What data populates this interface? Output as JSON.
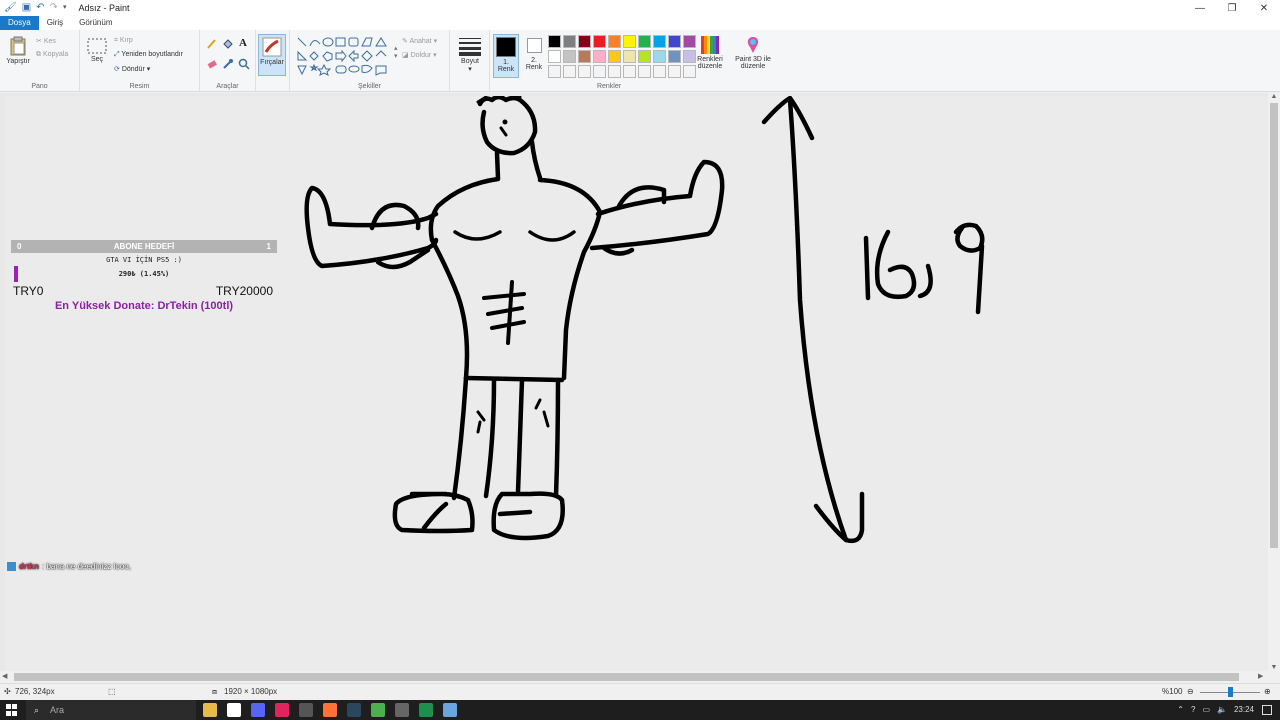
{
  "window": {
    "title": "Adsız - Paint",
    "controls": {
      "minimize": "—",
      "maximize": "❐",
      "close": "✕"
    }
  },
  "tabs": [
    {
      "label": "Dosya",
      "active": true
    },
    {
      "label": "Giriş",
      "active": false
    },
    {
      "label": "Görünüm",
      "active": false
    }
  ],
  "ribbon": {
    "pano": {
      "label": "Pano",
      "paste": "Yapıştır",
      "cut": "Kes",
      "copy": "Kopyala"
    },
    "resim": {
      "label": "Resim",
      "select": "Seç",
      "crop": "Kırp",
      "resize": "Yeniden boyutlandır",
      "rotate": "Döndür"
    },
    "araclar": {
      "label": "Araçlar"
    },
    "brushes": {
      "label": "Fırçalar"
    },
    "sekiller": {
      "label": "Şekiller",
      "outline": "Anahat",
      "fill": "Doldur"
    },
    "size": {
      "label": "Boyut"
    },
    "renkler": {
      "label": "Renkler",
      "color1": "1. Renk",
      "color2": "2. Renk",
      "edit_colors": "Renkleri düzenle",
      "paint3d": "Paint 3D ile düzenle",
      "color1_value": "#000000",
      "color2_value": "#ffffff",
      "palette": [
        "#000000",
        "#7f7f7f",
        "#880015",
        "#ed1c24",
        "#ff7f27",
        "#fff200",
        "#22b14c",
        "#00a2e8",
        "#3f48cc",
        "#a349a4",
        "#ffffff",
        "#c3c3c3",
        "#b97a57",
        "#ffaec9",
        "#ffc90e",
        "#efe4b0",
        "#b5e61d",
        "#99d9ea",
        "#7092be",
        "#c8bfe7",
        "#f4f4f4",
        "#f4f4f4",
        "#f4f4f4",
        "#f4f4f4",
        "#f4f4f4",
        "#f4f4f4",
        "#f4f4f4",
        "#f4f4f4",
        "#f4f4f4",
        "#f4f4f4"
      ]
    }
  },
  "overlay": {
    "goal_title": "ABONE HEDEFİ",
    "goal_min": "0",
    "goal_max": "1",
    "goal_name": "GTA VI İÇİN PS5 :)",
    "goal_progress_text": "290₺ (1.45%)",
    "goal_progress_fraction": 0.0145,
    "goal_start": "TRY0",
    "goal_end": "TRY20000",
    "top_donate": "En Yüksek Donate: DrTekin (100tl)",
    "chat_user": "drtkn",
    "chat_message": ": bana ne deedinizz looo,"
  },
  "status": {
    "cursor_pos": "726, 324px",
    "canvas_size": "1920 × 1080px",
    "zoom": "%100"
  },
  "taskbar": {
    "search_placeholder": "Ara",
    "time": "23:24",
    "icons": [
      "file-explorer-icon",
      "store-icon",
      "discord-icon",
      "app-red-icon",
      "calculator-icon",
      "firefox-icon",
      "steam-icon",
      "chrome-icon",
      "obs-icon",
      "excel-icon",
      "paint-icon"
    ],
    "icon_colors": [
      "#e8b84a",
      "#ffffff",
      "#5865f2",
      "#e0245e",
      "#555555",
      "#ff7139",
      "#2a475e",
      "#4caf50",
      "#666666",
      "#1f8f4e",
      "#6aa5e0"
    ]
  }
}
